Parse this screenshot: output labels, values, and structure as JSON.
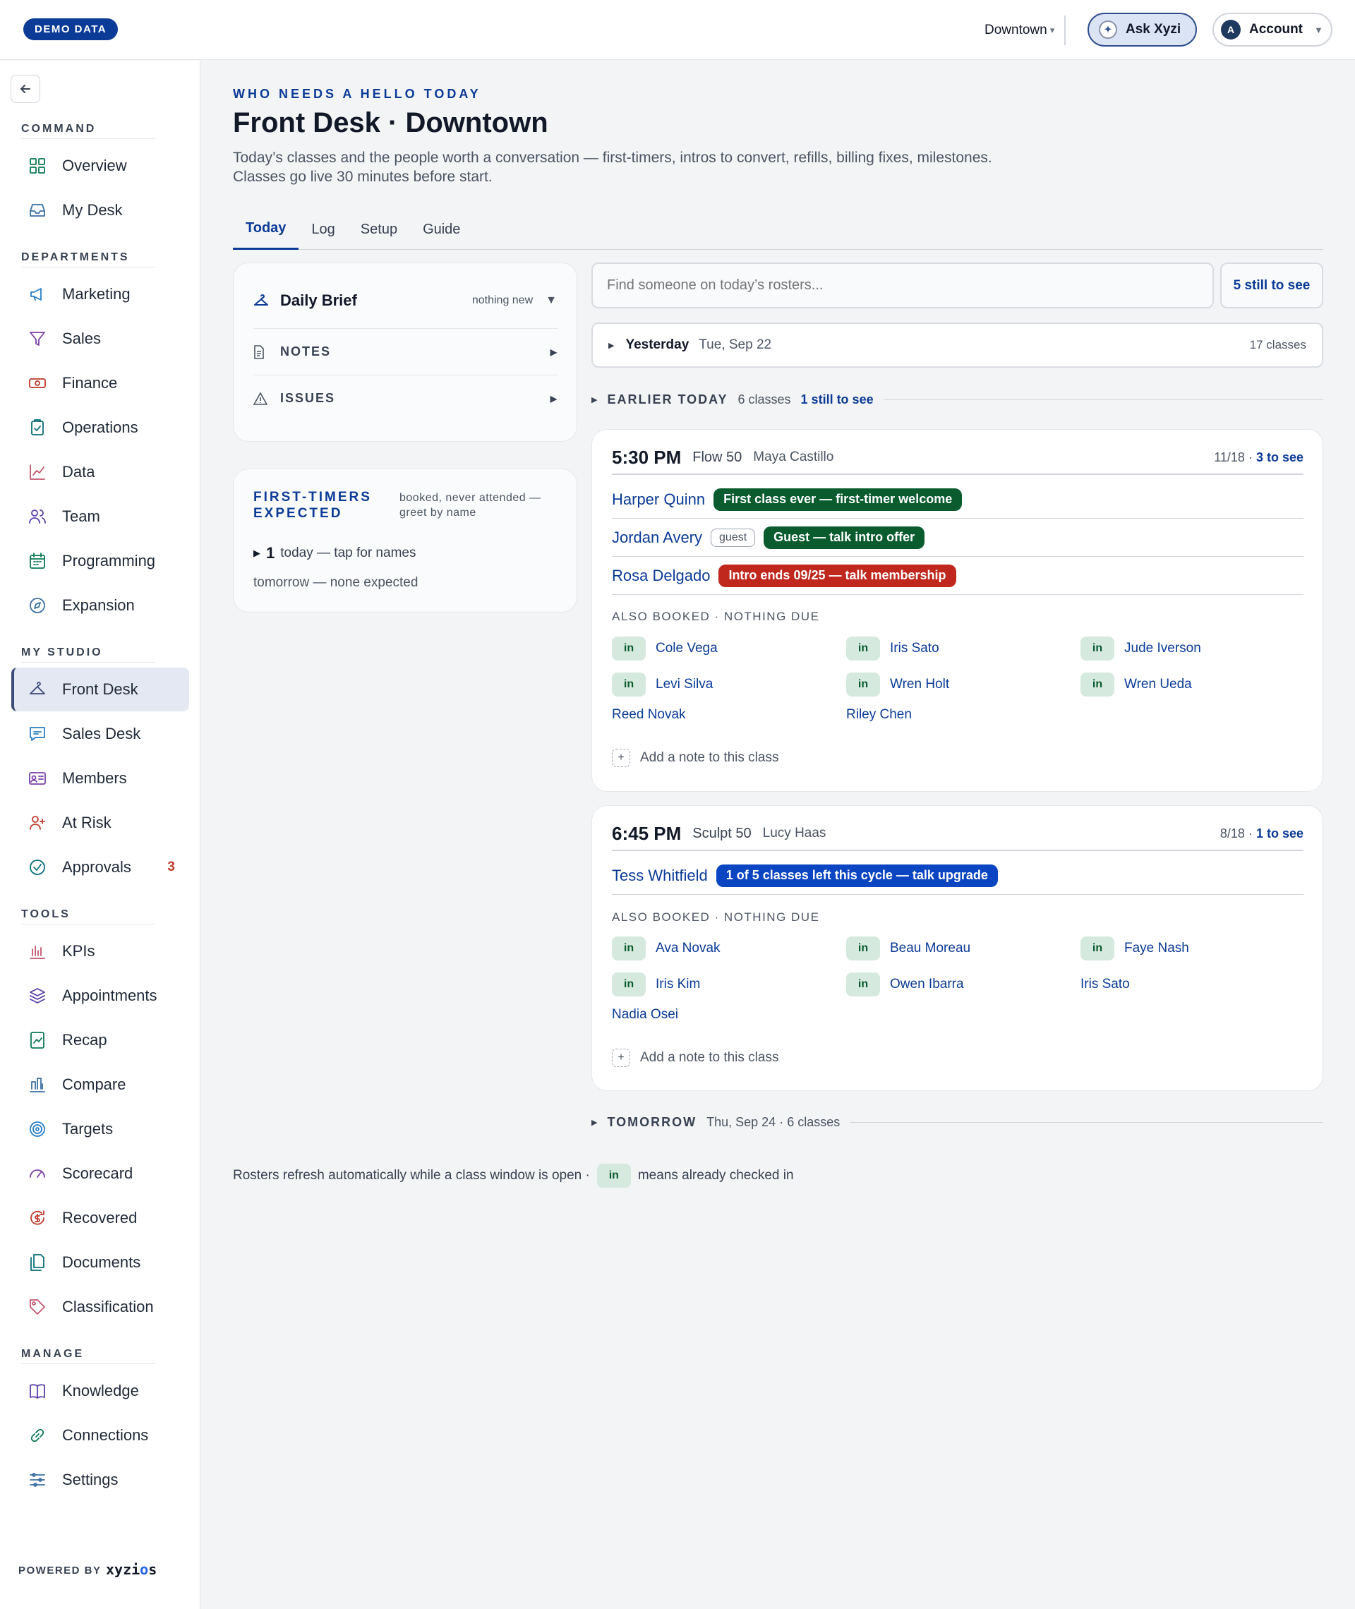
{
  "topbar": {
    "badge": "DEMO DATA",
    "location": "Downtown",
    "ask_label": "Ask Xyzi",
    "account_label": "Account",
    "account_initial": "A"
  },
  "sidebar": {
    "sections": [
      {
        "label": "COMMAND",
        "items": [
          {
            "label": "Overview",
            "icon": "grid-icon"
          },
          {
            "label": "My Desk",
            "icon": "inbox-icon"
          }
        ]
      },
      {
        "label": "DEPARTMENTS",
        "items": [
          {
            "label": "Marketing",
            "icon": "megaphone-icon"
          },
          {
            "label": "Sales",
            "icon": "filter-icon"
          },
          {
            "label": "Finance",
            "icon": "banknote-icon"
          },
          {
            "label": "Operations",
            "icon": "clipboard-icon"
          },
          {
            "label": "Data",
            "icon": "line-chart-icon"
          },
          {
            "label": "Team",
            "icon": "users-icon"
          },
          {
            "label": "Programming",
            "icon": "calendar-icon"
          },
          {
            "label": "Expansion",
            "icon": "compass-icon"
          }
        ]
      },
      {
        "label": "MY STUDIO",
        "items": [
          {
            "label": "Front Desk",
            "icon": "hanger-icon",
            "active": true
          },
          {
            "label": "Sales Desk",
            "icon": "chat-icon"
          },
          {
            "label": "Members",
            "icon": "id-card-icon"
          },
          {
            "label": "At Risk",
            "icon": "user-plus-icon"
          },
          {
            "label": "Approvals",
            "icon": "check-circle-icon",
            "count": "3"
          }
        ]
      },
      {
        "label": "TOOLS",
        "items": [
          {
            "label": "KPIs",
            "icon": "bar-chart-icon"
          },
          {
            "label": "Appointments",
            "icon": "layers-icon"
          },
          {
            "label": "Recap",
            "icon": "trend-doc-icon"
          },
          {
            "label": "Compare",
            "icon": "columns-icon"
          },
          {
            "label": "Targets",
            "icon": "target-icon"
          },
          {
            "label": "Scorecard",
            "icon": "gauge-icon"
          },
          {
            "label": "Recovered",
            "icon": "refresh-dollar-icon"
          },
          {
            "label": "Documents",
            "icon": "files-icon"
          },
          {
            "label": "Classification",
            "icon": "tag-icon"
          }
        ]
      },
      {
        "label": "MANAGE",
        "items": [
          {
            "label": "Knowledge",
            "icon": "book-icon"
          },
          {
            "label": "Connections",
            "icon": "link-icon"
          },
          {
            "label": "Settings",
            "icon": "sliders-icon"
          }
        ]
      }
    ],
    "powered_by": "POWERED BY",
    "brand": "xyzios"
  },
  "header": {
    "eyebrow": "WHO NEEDS A HELLO TODAY",
    "title": "Front Desk · Downtown",
    "subtitle": "Today’s classes and the people worth a conversation — first-timers, intros to convert, refills, billing fixes, milestones. Classes go live 30 minutes before start.",
    "tabs": [
      "Today",
      "Log",
      "Setup",
      "Guide"
    ]
  },
  "brief": {
    "title": "Daily Brief",
    "meta": "nothing new",
    "rows": [
      "NOTES",
      "ISSUES"
    ]
  },
  "first_timers": {
    "title": "FIRST-TIMERS EXPECTED",
    "desc": "booked, never attended — greet by name",
    "today_count": "1",
    "today_text": "today — tap for names",
    "tomorrow": "tomorrow — none expected"
  },
  "roster": {
    "search_placeholder": "Find someone on today’s rosters...",
    "still_to_see": "5 still to see",
    "yesterday": {
      "label": "Yesterday",
      "date": "Tue, Sep 22",
      "count": "17 classes"
    },
    "earlier": {
      "label": "EARLIER TODAY",
      "count": "6 classes",
      "link": "1 still to see"
    },
    "tomorrow": {
      "label": "TOMORROW",
      "meta": "Thu, Sep 24 · 6 classes"
    },
    "also_label": "ALSO BOOKED · NOTHING DUE",
    "add_note": "Add a note to this class",
    "in_label": "in",
    "classes": [
      {
        "time": "5:30 PM",
        "name": "Flow 50",
        "instructor": "Maya Castillo",
        "count": "11/18 ·",
        "to_see": "3 to see",
        "people": [
          {
            "name": "Harper Quinn",
            "tag": "First class ever — first-timer welcome",
            "color": "green"
          },
          {
            "name": "Jordan Avery",
            "guest": "guest",
            "tag": "Guest — talk intro offer",
            "color": "green"
          },
          {
            "name": "Rosa Delgado",
            "tag": "Intro ends 09/25 — talk membership",
            "color": "red"
          }
        ],
        "also": [
          {
            "name": "Cole Vega",
            "in": true
          },
          {
            "name": "Iris Sato",
            "in": true
          },
          {
            "name": "Jude Iverson",
            "in": true
          },
          {
            "name": "Levi Silva",
            "in": true
          },
          {
            "name": "Wren Holt",
            "in": true
          },
          {
            "name": "Wren Ueda",
            "in": true
          },
          {
            "name": "Reed Novak",
            "in": false
          },
          {
            "name": "Riley Chen",
            "in": false
          }
        ]
      },
      {
        "time": "6:45 PM",
        "name": "Sculpt 50",
        "instructor": "Lucy Haas",
        "count": "8/18 ·",
        "to_see": "1 to see",
        "people": [
          {
            "name": "Tess Whitfield",
            "tag": "1 of 5 classes left this cycle — talk upgrade",
            "color": "blue"
          }
        ],
        "also": [
          {
            "name": "Ava Novak",
            "in": true
          },
          {
            "name": "Beau Moreau",
            "in": true
          },
          {
            "name": "Faye Nash",
            "in": true
          },
          {
            "name": "Iris Kim",
            "in": true
          },
          {
            "name": "Owen Ibarra",
            "in": true
          },
          {
            "name": "Iris Sato",
            "in": false
          },
          {
            "name": "Nadia Osei",
            "in": false
          }
        ]
      }
    ]
  },
  "footnote": {
    "before": "Rosters refresh automatically while a class window is open ·",
    "after": "means already checked in"
  }
}
